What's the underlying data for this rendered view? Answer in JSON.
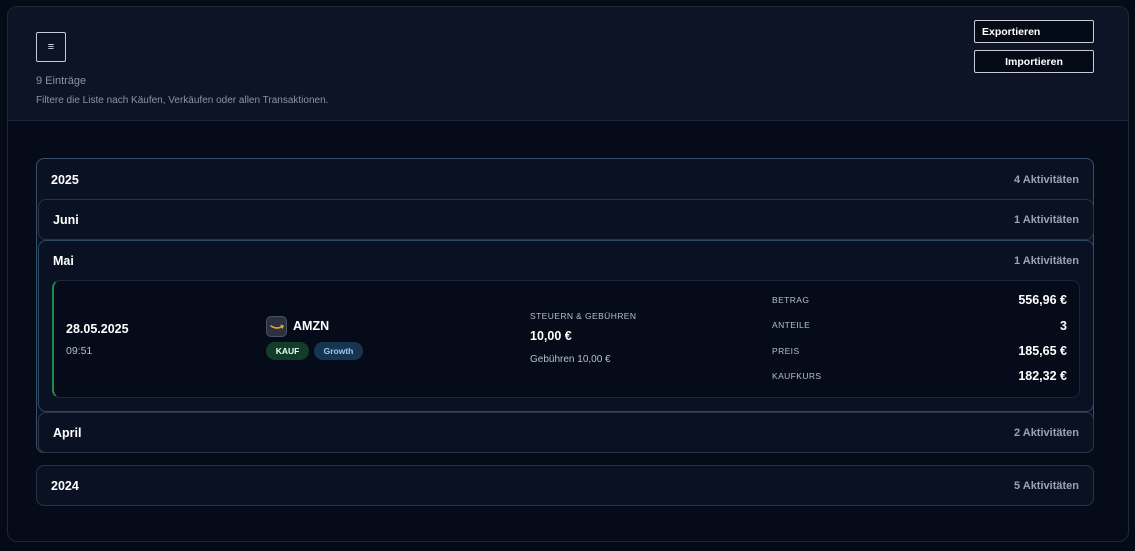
{
  "header": {
    "menu_glyph": "≡",
    "entry_count": "9 Einträge",
    "hint": "Filtere die Liste nach Käufen, Verkäufen oder allen Transaktionen.",
    "export_label": "Exportieren",
    "import_label": "Importieren"
  },
  "years": [
    {
      "title": "2025",
      "count": "4 Aktivitäten",
      "months": [
        {
          "title": "Juni",
          "count": "1 Aktivitäten"
        },
        {
          "title": "Mai",
          "count": "1 Aktivitäten",
          "transaction": {
            "date": "28.05.2025",
            "time": "09:51",
            "ticker": "AMZN",
            "logo_icon": "amazon-logo-icon",
            "type_badge": "KAUF",
            "category_badge": "Growth",
            "fees_label": "STEUERN & GEBÜHREN",
            "fees_value": "10,00 €",
            "fees_detail": "Gebühren 10,00 €",
            "amount_label": "BETRAG",
            "amount_value": "556,96 €",
            "shares_label": "ANTEILE",
            "shares_value": "3",
            "price_label": "PREIS",
            "price_value": "185,65 €",
            "buy_rate_label": "KAUFKURS",
            "buy_rate_value": "182,32 €"
          }
        },
        {
          "title": "April",
          "count": "2 Aktivitäten"
        }
      ]
    },
    {
      "title": "2024",
      "count": "5 Aktivitäten"
    }
  ],
  "colors": {
    "background": "#050a17",
    "buy_accent": "#1f8a4c",
    "growth_badge": "#173550"
  }
}
